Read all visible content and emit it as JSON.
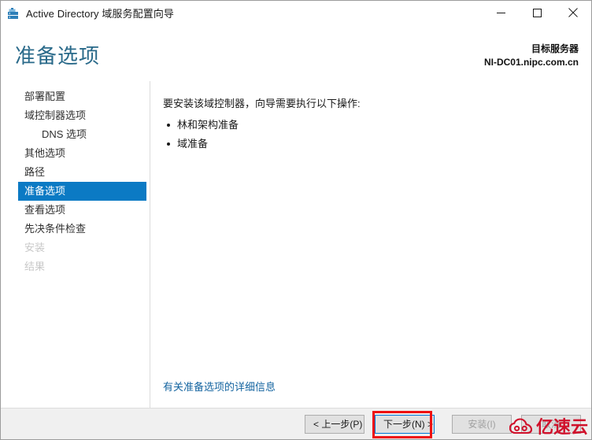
{
  "window": {
    "title": "Active Directory 域服务配置向导",
    "icon": "ad-server-icon",
    "controls": {
      "minimize": "minimize-icon",
      "maximize": "maximize-icon",
      "close": "close-icon"
    }
  },
  "header": {
    "page_title": "准备选项",
    "target_label": "目标服务器",
    "target_server": "NI-DC01.nipc.com.cn"
  },
  "sidebar": {
    "items": [
      {
        "label": "部署配置",
        "state": "normal",
        "indent": false
      },
      {
        "label": "域控制器选项",
        "state": "normal",
        "indent": false
      },
      {
        "label": "DNS 选项",
        "state": "normal",
        "indent": true
      },
      {
        "label": "其他选项",
        "state": "normal",
        "indent": false
      },
      {
        "label": "路径",
        "state": "normal",
        "indent": false
      },
      {
        "label": "准备选项",
        "state": "selected",
        "indent": false
      },
      {
        "label": "查看选项",
        "state": "normal",
        "indent": false
      },
      {
        "label": "先决条件检查",
        "state": "normal",
        "indent": false
      },
      {
        "label": "安装",
        "state": "disabled",
        "indent": false
      },
      {
        "label": "结果",
        "state": "disabled",
        "indent": false
      }
    ]
  },
  "content": {
    "intro": "要安装该域控制器，向导需要执行以下操作:",
    "operations": [
      "林和架构准备",
      "域准备"
    ],
    "help_link": "有关准备选项的详细信息"
  },
  "footer": {
    "previous": "< 上一步(P)",
    "next": "下一步(N) >",
    "install": "安装(I)",
    "cancel": "取消"
  },
  "watermark": {
    "text": "亿速云",
    "logo": "cloud-logo-icon"
  },
  "colors": {
    "accent_blue": "#0b7ac4",
    "title_teal": "#2a6a8a",
    "link_blue": "#1464a0",
    "annotation_red": "#ee1111",
    "watermark_red": "#d0112b"
  }
}
